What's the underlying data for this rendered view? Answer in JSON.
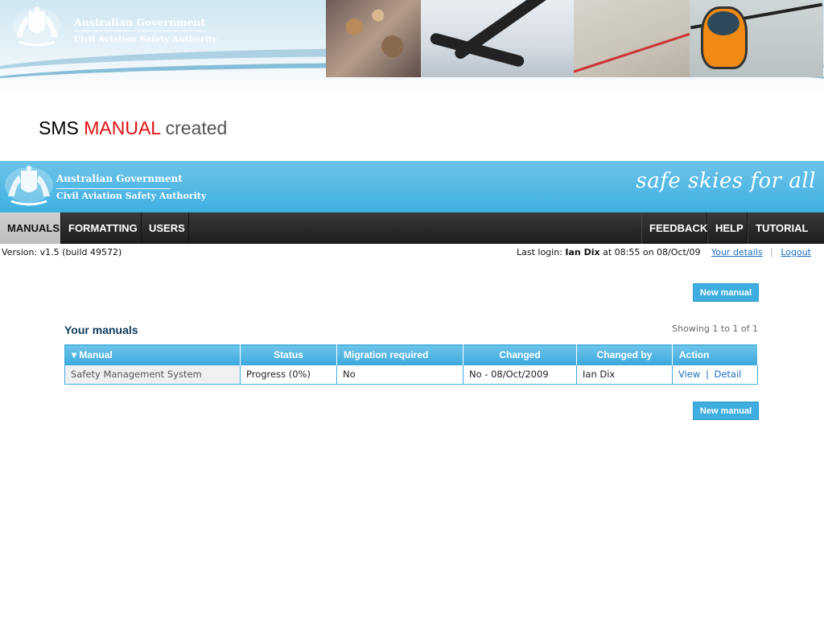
{
  "slide_banner": {
    "agency_line1": "Australian Government",
    "agency_line2": "Civil Aviation Safety Authority",
    "crest_icon": "coat-of-arms-icon"
  },
  "slide_heading": {
    "word1": "SMS",
    "word2": "MANUAL",
    "word3": "created",
    "accent_color": "#e01010"
  },
  "app": {
    "header": {
      "agency_line1": "Australian Government",
      "agency_line2": "Civil Aviation Safety Authority",
      "tagline": "safe skies for all",
      "brand_color": "#3fb0e2"
    },
    "nav": {
      "left": [
        {
          "label": "MANUALS",
          "active": true
        },
        {
          "label": "FORMATTING",
          "active": false
        },
        {
          "label": "USERS",
          "active": false
        }
      ],
      "right": [
        {
          "label": "FEEDBACK"
        },
        {
          "label": "HELP"
        },
        {
          "label": "TUTORIAL"
        }
      ]
    },
    "version": "Version: v1.5 (build 49572)",
    "login": {
      "prefix": "Last login:",
      "user": "Ian Dix",
      "time_text": "at 08:55 on 08/Oct/09",
      "your_details": "Your details",
      "logout": "Logout"
    },
    "new_manual_label": "New manual",
    "manuals": {
      "title": "Your manuals",
      "showing": "Showing 1 to 1 of 1",
      "columns": [
        "Manual",
        "Status",
        "Migration required",
        "Changed",
        "Changed by",
        "Action"
      ],
      "sort_indicator": "▾",
      "rows": [
        {
          "manual": "Safety Management System",
          "status": "Progress (0%)",
          "migration": "No",
          "changed": "No - 08/Oct/2009",
          "changed_by": "Ian Dix",
          "action_view": "View",
          "action_sep": "|",
          "action_detail": "Detail"
        }
      ]
    }
  }
}
